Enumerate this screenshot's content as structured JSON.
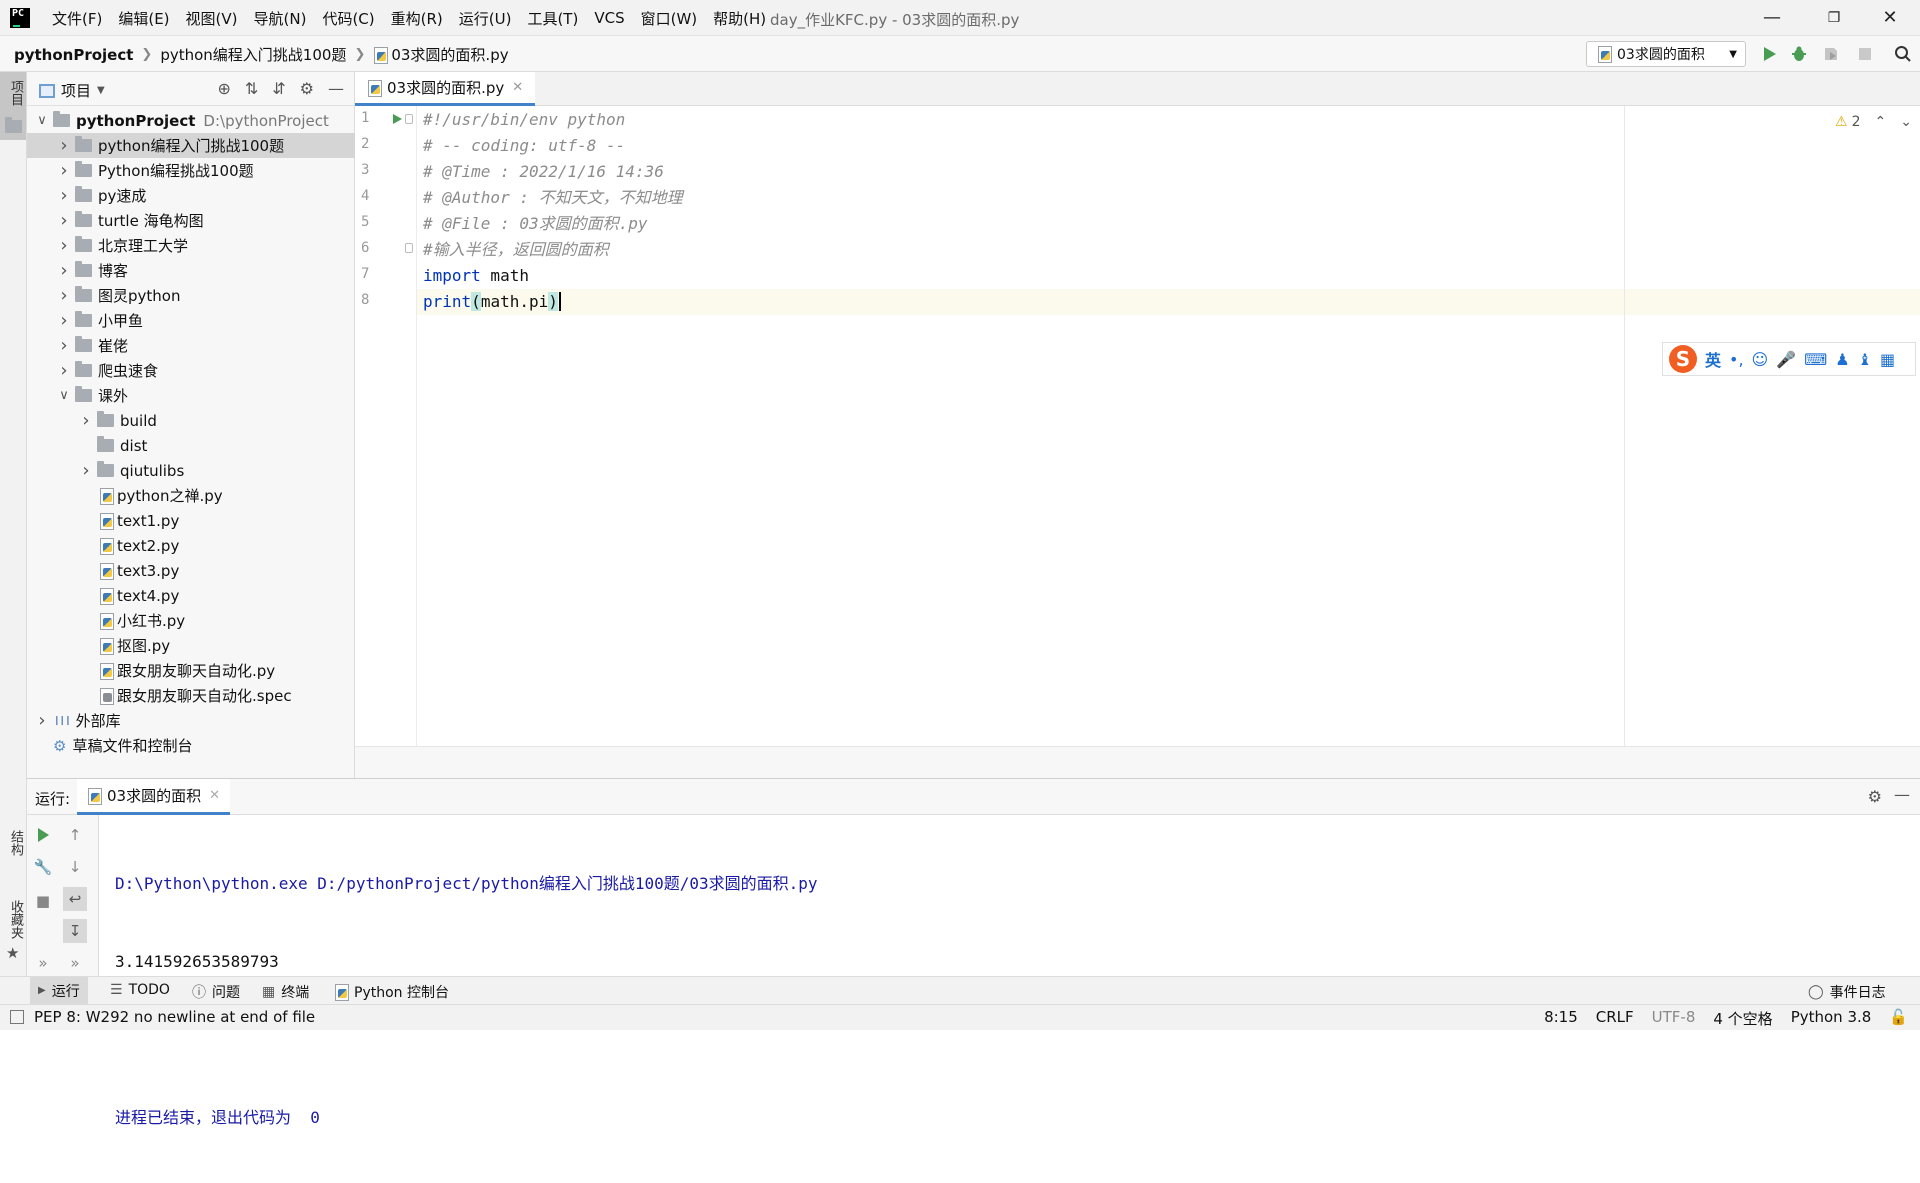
{
  "app": {
    "window_title": "day_作业KFC.py - 03求圆的面积.py",
    "menu": [
      "文件(F)",
      "编辑(E)",
      "视图(V)",
      "导航(N)",
      "代码(C)",
      "重构(R)",
      "运行(U)",
      "工具(T)",
      "VCS",
      "窗口(W)",
      "帮助(H)"
    ],
    "logo_text": "PC"
  },
  "navbar": {
    "crumbs": [
      "pythonProject",
      "python编程入门挑战100题",
      "03求圆的面积.py"
    ],
    "run_config": "03求圆的面积"
  },
  "left_stripe": {
    "project_tab": "项目",
    "structure_tab": "结构",
    "favorites_tab": "收藏夹"
  },
  "project": {
    "header": "项目",
    "tree": [
      {
        "label": "pythonProject",
        "extra": "D:\\pythonProject",
        "type": "folder",
        "depth": 0,
        "expanded": true,
        "bold": true
      },
      {
        "label": "python编程入门挑战100题",
        "type": "folder",
        "depth": 1,
        "expanded": false,
        "selected": true
      },
      {
        "label": "Python编程挑战100题",
        "type": "folder",
        "depth": 1,
        "expanded": false
      },
      {
        "label": "py速成",
        "type": "folder",
        "depth": 1,
        "expanded": false
      },
      {
        "label": "turtle 海龟构图",
        "type": "folder",
        "depth": 1,
        "expanded": false
      },
      {
        "label": "北京理工大学",
        "type": "folder",
        "depth": 1,
        "expanded": false
      },
      {
        "label": "博客",
        "type": "folder",
        "depth": 1,
        "expanded": false
      },
      {
        "label": "图灵python",
        "type": "folder",
        "depth": 1,
        "expanded": false
      },
      {
        "label": "小甲鱼",
        "type": "folder",
        "depth": 1,
        "expanded": false
      },
      {
        "label": "崔佬",
        "type": "folder",
        "depth": 1,
        "expanded": false
      },
      {
        "label": "爬虫速食",
        "type": "folder",
        "depth": 1,
        "expanded": false
      },
      {
        "label": "课外",
        "type": "folder",
        "depth": 1,
        "expanded": true
      },
      {
        "label": "build",
        "type": "folder",
        "depth": 2,
        "expanded": false
      },
      {
        "label": "dist",
        "type": "folder",
        "depth": 2,
        "leaf": true
      },
      {
        "label": "qiutulibs",
        "type": "folder",
        "depth": 2,
        "expanded": false
      },
      {
        "label": "python之禅.py",
        "type": "py",
        "depth": 2
      },
      {
        "label": "text1.py",
        "type": "py",
        "depth": 2
      },
      {
        "label": "text2.py",
        "type": "py",
        "depth": 2
      },
      {
        "label": "text3.py",
        "type": "py",
        "depth": 2
      },
      {
        "label": "text4.py",
        "type": "py",
        "depth": 2
      },
      {
        "label": "小红书.py",
        "type": "py",
        "depth": 2
      },
      {
        "label": "抠图.py",
        "type": "py",
        "depth": 2
      },
      {
        "label": "跟女朋友聊天自动化.py",
        "type": "py",
        "depth": 2
      },
      {
        "label": "跟女朋友聊天自动化.spec",
        "type": "spec",
        "depth": 2
      },
      {
        "label": "外部库",
        "type": "lib",
        "depth": 0,
        "expanded": false
      },
      {
        "label": "草稿文件和控制台",
        "type": "scratch",
        "depth": 0
      }
    ]
  },
  "editor": {
    "tab": "03求圆的面积.py",
    "warnings": "2",
    "lines": [
      "#!/usr/bin/env python",
      "# -- coding: utf-8 --",
      "# @Time : 2022/1/16 14:36",
      "# @Author : 不知天文，不知地理",
      "# @File : 03求圆的面积.py",
      "#输入半径，返回圆的面积",
      "import math",
      "print(math.pi)"
    ],
    "line_numbers": [
      "1",
      "2",
      "3",
      "4",
      "5",
      "6",
      "7",
      "8"
    ],
    "code_kw_import": "import",
    "code_import_rest": " math",
    "code_print": "print",
    "code_open": "(",
    "code_arg": "math.pi",
    "code_close": ")"
  },
  "ime": {
    "logo": "S",
    "lang": "英",
    "punct": "•,"
  },
  "run": {
    "label": "运行:",
    "tab": "03求圆的面积",
    "output": [
      "D:\\Python\\python.exe D:/pythonProject/python编程入门挑战100题/03求圆的面积.py",
      "3.141592653589793",
      "",
      "进程已结束，退出代码为  0"
    ]
  },
  "bottom_tabs": {
    "run": "运行",
    "todo": "TODO",
    "problems": "问题",
    "terminal": "终端",
    "python_console": "Python 控制台",
    "event_log": "事件日志"
  },
  "status": {
    "message": "PEP 8: W292 no newline at end of file",
    "position": "8:15",
    "line_sep": "CRLF",
    "encoding": "UTF-8",
    "indent": "4 个空格",
    "interpreter": "Python 3.8"
  },
  "colors": {
    "accent": "#4083c9",
    "run_green": "#499c54",
    "comment": "#8c8c8c",
    "keyword": "#0033b3"
  }
}
